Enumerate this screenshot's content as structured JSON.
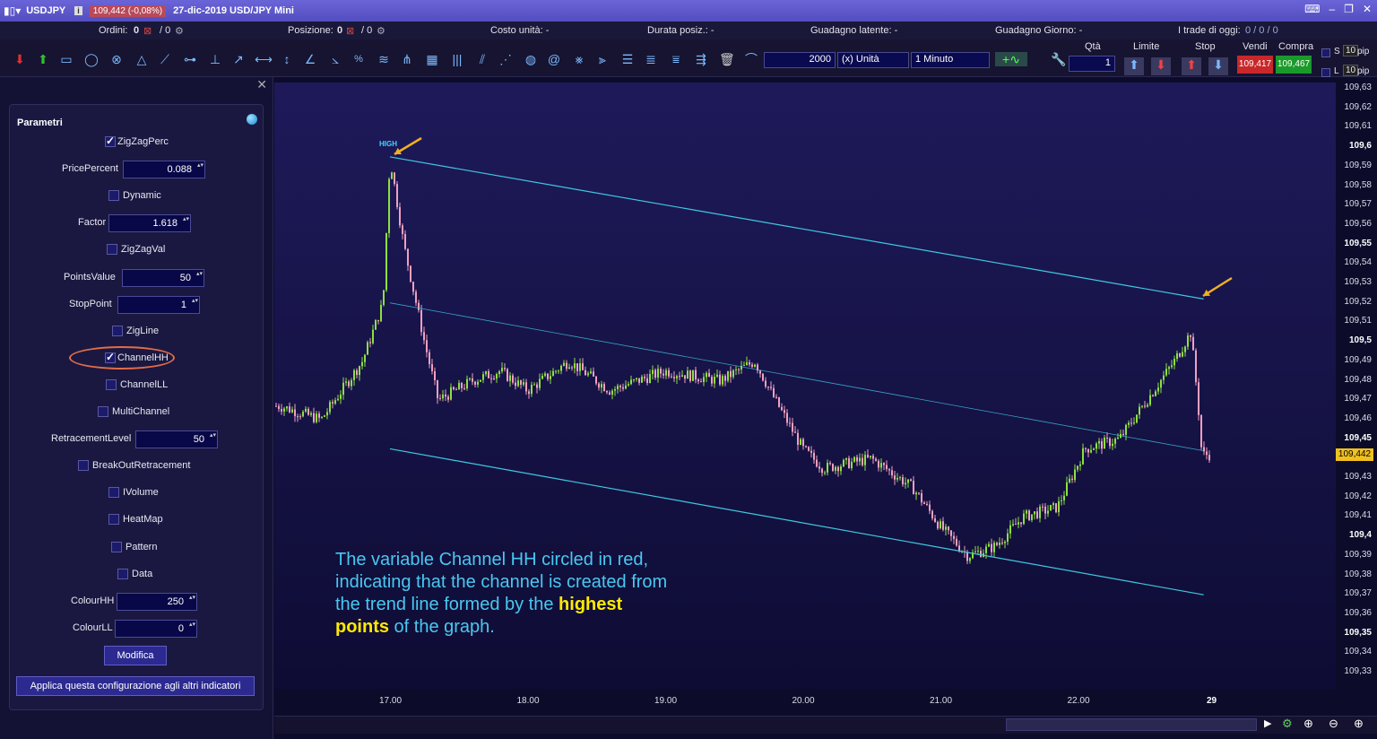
{
  "titlebar": {
    "symbol": "USDJPY",
    "price_change": "109,442 (-0,08%)",
    "date_title": "27-dic-2019 USD/JPY Mini",
    "colors": {
      "bar": "#5a55c8",
      "change_bg": "#b84a5a"
    }
  },
  "infobar": {
    "ordini_label": "Ordini:",
    "ordini_value": "0",
    "ordini_sep": "/ 0",
    "posizione_label": "Posizione:",
    "posizione_value": "0",
    "posizione_sep": "/ 0",
    "costo": "Costo unità: -",
    "durata": "Durata posiz.: -",
    "guadagno_latente": "Guadagno latente: -",
    "guadagno_giorno": "Guadagno Giorno: -",
    "trade_oggi_label": "I trade di oggi:",
    "trade_oggi_value": "0 / 0 / 0"
  },
  "toolbar": {
    "units_value": "2000",
    "units_type": "(x) Unità",
    "timeframe": "1 Minuto",
    "qta_label": "Qtà",
    "qta_value": "1",
    "limite_label": "Limite",
    "stop_label": "Stop",
    "vendi_label": "Vendi",
    "compra_label": "Compra",
    "vendi_price": "109,417",
    "compra_price": "109,467",
    "pip_value_1": "10",
    "pip_value_2": "10",
    "pip_label": "pip",
    "s_label": "S",
    "l_label": "L",
    "colors": {
      "sell": "#c8282a",
      "buy": "#1a9a2a"
    }
  },
  "panel": {
    "title": "Parametri",
    "params": [
      {
        "type": "checkbox",
        "label": "ZigZagPerc",
        "checked": true
      },
      {
        "type": "number",
        "label": "PricePercent",
        "value": "0.088"
      },
      {
        "type": "checkbox",
        "label": "Dynamic",
        "checked": false
      },
      {
        "type": "number",
        "label": "Factor",
        "value": "1.618"
      },
      {
        "type": "checkbox",
        "label": "ZigZagVal",
        "checked": false
      },
      {
        "type": "number",
        "label": "PointsValue",
        "value": "50"
      },
      {
        "type": "number",
        "label": "StopPoint",
        "value": "1"
      },
      {
        "type": "checkbox",
        "label": "ZigLine",
        "checked": false
      },
      {
        "type": "checkbox",
        "label": "ChannelHH",
        "checked": true
      },
      {
        "type": "checkbox",
        "label": "ChannelLL",
        "checked": false
      },
      {
        "type": "checkbox",
        "label": "MultiChannel",
        "checked": false
      },
      {
        "type": "number",
        "label": "RetracementLevel",
        "value": "50"
      },
      {
        "type": "checkbox",
        "label": "BreakOutRetracement",
        "checked": false
      },
      {
        "type": "checkbox",
        "label": "IVolume",
        "checked": false
      },
      {
        "type": "checkbox",
        "label": "HeatMap",
        "checked": false
      },
      {
        "type": "checkbox",
        "label": "Pattern",
        "checked": false
      },
      {
        "type": "checkbox",
        "label": "Data",
        "checked": false
      },
      {
        "type": "number",
        "label": "ColourHH",
        "value": "250"
      },
      {
        "type": "number",
        "label": "ColourLL",
        "value": "0"
      }
    ],
    "modify_button": "Modifica",
    "apply_button": "Applica questa configurazione agli altri indicatori",
    "highlight_color": "#e26b4a"
  },
  "chart": {
    "high_label": "HIGH",
    "current_price": "109,442",
    "annotation": {
      "part1": "The variable Channel HH circled in red, indicating that the channel is created from the trend line formed by the ",
      "highlight": "highest points",
      "part2": " of the graph."
    },
    "colors": {
      "channel": "#40c8e0",
      "up": "#8de040",
      "down": "#f0a0c0",
      "arrow": "#f0b020",
      "annotation": "#49c8f0",
      "highlight": "#ffea00"
    }
  },
  "chart_data": {
    "type": "candlestick",
    "x_ticks": [
      "17.00",
      "18.00",
      "19.00",
      "20.00",
      "21.00",
      "22.00",
      "29"
    ],
    "y_ticks": [
      "109,63",
      "109,62",
      "109,61",
      "109,6",
      "109,59",
      "109,58",
      "109,57",
      "109,56",
      "109,55",
      "109,54",
      "109,53",
      "109,52",
      "109,51",
      "109,5",
      "109,49",
      "109,48",
      "109,47",
      "109,46",
      "109,45",
      "109,44",
      "109,43",
      "109,42",
      "109,41",
      "109,4",
      "109,39",
      "109,38",
      "109,37",
      "109,36",
      "109,35",
      "109,34",
      "109,33"
    ],
    "y_bold": [
      "109,6",
      "109,55",
      "109,5",
      "109,45",
      "109,4",
      "109,35"
    ],
    "ylim": [
      109.33,
      109.63
    ],
    "price_path": [
      {
        "t": 16.2,
        "p": 109.467
      },
      {
        "t": 16.5,
        "p": 109.46
      },
      {
        "t": 16.8,
        "p": 109.49
      },
      {
        "t": 16.95,
        "p": 109.52
      },
      {
        "t": 17.0,
        "p": 109.595
      },
      {
        "t": 17.1,
        "p": 109.55
      },
      {
        "t": 17.25,
        "p": 109.5
      },
      {
        "t": 17.35,
        "p": 109.47
      },
      {
        "t": 17.6,
        "p": 109.48
      },
      {
        "t": 17.8,
        "p": 109.485
      },
      {
        "t": 18.0,
        "p": 109.475
      },
      {
        "t": 18.3,
        "p": 109.49
      },
      {
        "t": 18.6,
        "p": 109.475
      },
      {
        "t": 19.0,
        "p": 109.485
      },
      {
        "t": 19.4,
        "p": 109.48
      },
      {
        "t": 19.65,
        "p": 109.49
      },
      {
        "t": 19.8,
        "p": 109.47
      },
      {
        "t": 20.0,
        "p": 109.445
      },
      {
        "t": 20.15,
        "p": 109.435
      },
      {
        "t": 20.5,
        "p": 109.44
      },
      {
        "t": 20.8,
        "p": 109.425
      },
      {
        "t": 21.0,
        "p": 109.405
      },
      {
        "t": 21.2,
        "p": 109.39
      },
      {
        "t": 21.4,
        "p": 109.395
      },
      {
        "t": 21.6,
        "p": 109.41
      },
      {
        "t": 21.85,
        "p": 109.415
      },
      {
        "t": 22.05,
        "p": 109.445
      },
      {
        "t": 22.3,
        "p": 109.45
      },
      {
        "t": 22.5,
        "p": 109.47
      },
      {
        "t": 22.7,
        "p": 109.49
      },
      {
        "t": 22.82,
        "p": 109.505
      },
      {
        "t": 22.87,
        "p": 109.47
      },
      {
        "t": 22.9,
        "p": 109.442
      }
    ],
    "channel": {
      "upper": [
        {
          "t": 17.0,
          "p": 109.595
        },
        {
          "t": 22.9,
          "p": 109.522
        }
      ],
      "middle": [
        {
          "t": 17.0,
          "p": 109.52
        },
        {
          "t": 22.9,
          "p": 109.444
        }
      ],
      "lower": [
        {
          "t": 17.0,
          "p": 109.445
        },
        {
          "t": 22.9,
          "p": 109.37
        }
      ]
    }
  }
}
